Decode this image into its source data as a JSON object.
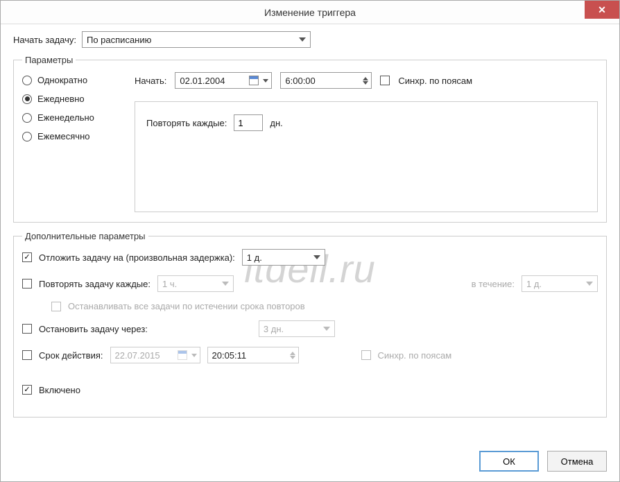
{
  "window": {
    "title": "Изменение триггера"
  },
  "begin": {
    "label": "Начать задачу:",
    "value": "По расписанию"
  },
  "params": {
    "legend": "Параметры",
    "radios": {
      "once": "Однократно",
      "daily": "Ежедневно",
      "weekly": "Еженедельно",
      "monthly": "Ежемесячно",
      "selected": "daily"
    },
    "start_label": "Начать:",
    "date": "02.01.2004",
    "time": "6:00:00",
    "sync_tz": "Синхр. по поясам",
    "repeat_label": "Повторять каждые:",
    "repeat_value": "1",
    "repeat_unit": "дн."
  },
  "adv": {
    "legend": "Дополнительные параметры",
    "delay_label": "Отложить задачу на (произвольная задержка):",
    "delay_value": "1 д.",
    "repeat_task": "Повторять задачу каждые:",
    "repeat_task_value": "1 ч.",
    "during": "в течение:",
    "during_value": "1 д.",
    "stop_all": "Останавливать все задачи по истечении срока повторов",
    "stop_after": "Остановить задачу через:",
    "stop_after_value": "3 дн.",
    "expire": "Срок действия:",
    "expire_date": "22.07.2015",
    "expire_time": "20:05:11",
    "sync_tz2": "Синхр. по поясам",
    "enabled": "Включено"
  },
  "buttons": {
    "ok": "ОК",
    "cancel": "Отмена"
  },
  "watermark": "itdell.ru"
}
